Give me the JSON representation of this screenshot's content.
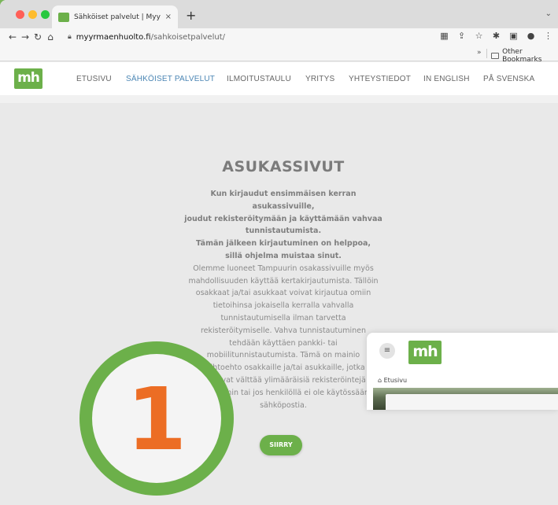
{
  "browser": {
    "tab_title": "Sähköiset palvelut | Myyrmäen",
    "tab_close": "×",
    "new_tab": "+",
    "tab_menu": "⌄",
    "url_host": "myyrmaenhuolto.fi",
    "url_path": "/sahkoisetpalvelut/",
    "bookmarks_overflow": "»",
    "bookmarks_folder": "Other Bookmarks"
  },
  "site": {
    "logo_text": "mh",
    "nav": [
      {
        "label": "ETUSIVU",
        "active": false
      },
      {
        "label": "SÄHKÖISET PALVELUT",
        "active": true
      },
      {
        "label": "ILMOITUSTAULU",
        "active": false
      },
      {
        "label": "YRITYS",
        "active": false
      },
      {
        "label": "YHTEYSTIEDOT",
        "active": false
      },
      {
        "label": "IN ENGLISH",
        "active": false
      },
      {
        "label": "PÅ SVENSKA",
        "active": false
      }
    ]
  },
  "main": {
    "headline": "ASUKASSIVUT",
    "bold_lines": [
      "Kun kirjaudut ensimmäisen kerran",
      "asukassivuille,",
      "joudut rekisteröitymään ja käyttämään vahvaa",
      "tunnistautumista.",
      "Tämän jälkeen kirjautuminen on helppoa,",
      "sillä ohjelma muistaa sinut."
    ],
    "body_lines": [
      "Olemme luoneet Tampuurin osakassivuille myös",
      "mahdollisuuden käyttää kertakirjautumista. Tällöin",
      "osakkaat ja/tai asukkaat voivat kirjautua omiin",
      "tietoihinsa jokaisella kerralla vahvalla",
      "tunnistautumisella ilman tarvetta",
      "rekisteröitymiselle. Vahva tunnistautuminen",
      "tehdään käyttäen pankki- tai",
      "mobiilitunnistautumista. Tämä on mainio",
      "vaihtoehto osakkaille ja/tai asukkaille, jotka",
      "haluavat välttää ylimääräisiä rekisteröintejä",
      "palveluihin tai jos henkilöllä ei ole käytössään",
      "sähköpostia."
    ],
    "cta_label": "SIIRRY"
  },
  "step": {
    "number": "1",
    "accent_color": "#6cb04a",
    "number_color": "#ec6d24"
  },
  "mobile_preview": {
    "menu_icon": "≡",
    "logo_text": "mh",
    "breadcrumb": "Etusivu",
    "home_icon": "⌂"
  },
  "colors": {
    "brand_green": "#6cb04a",
    "nav_active": "#4b86b4",
    "page_background": "#7ab55a"
  }
}
